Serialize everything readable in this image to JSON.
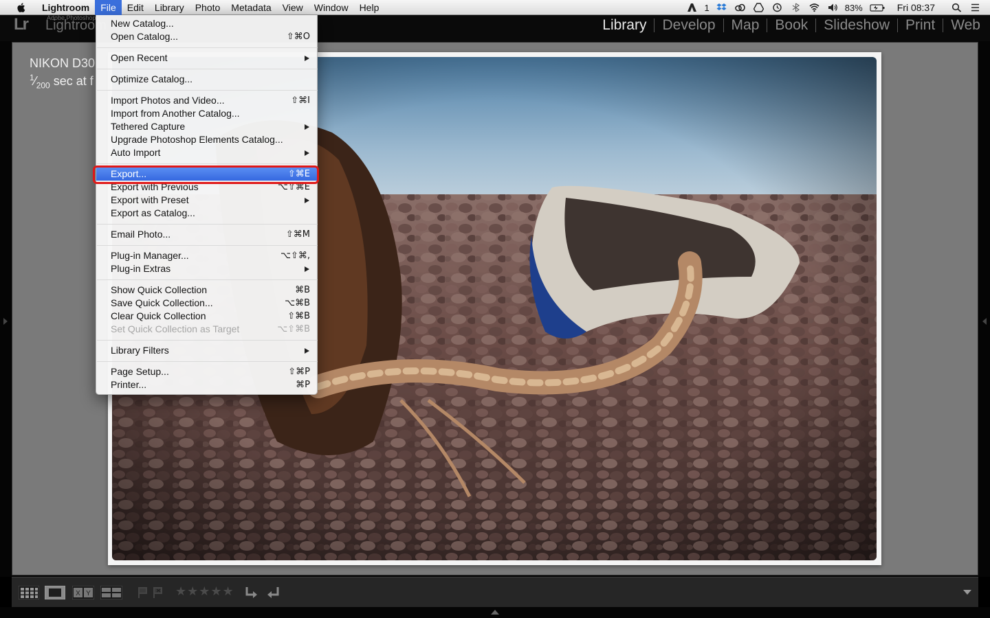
{
  "menubar": {
    "app": "Lightroom",
    "items": [
      "File",
      "Edit",
      "Library",
      "Photo",
      "Metadata",
      "View",
      "Window",
      "Help"
    ],
    "status": {
      "adobe_count": "1",
      "battery": "83%",
      "clock": "Fri 08:37"
    }
  },
  "lr": {
    "adobe_label": "Adobe Photoshop",
    "app_name": "Lightroom",
    "modules": [
      "Library",
      "Develop",
      "Map",
      "Book",
      "Slideshow",
      "Print",
      "Web"
    ],
    "active_module": "Library"
  },
  "photo_info": {
    "camera": "NIKON D30",
    "exposure_sup": "1",
    "exposure_sub": "200",
    "exposure_rest": " sec at f"
  },
  "toolbar": {
    "compare_label": "X|Y",
    "stars": "★★★★★"
  },
  "file_menu": {
    "items": [
      {
        "label": "New Catalog...",
        "shortcut": ""
      },
      {
        "label": "Open Catalog...",
        "shortcut": "⇧⌘O"
      },
      {
        "label": "Open Recent",
        "shortcut": "",
        "submenu": true
      },
      {
        "label": "Optimize Catalog...",
        "shortcut": ""
      },
      {
        "label": "Import Photos and Video...",
        "shortcut": "⇧⌘I"
      },
      {
        "label": "Import from Another Catalog...",
        "shortcut": ""
      },
      {
        "label": "Tethered Capture",
        "shortcut": "",
        "submenu": true
      },
      {
        "label": "Upgrade Photoshop Elements Catalog...",
        "shortcut": ""
      },
      {
        "label": "Auto Import",
        "shortcut": "",
        "submenu": true
      },
      {
        "label": "Export...",
        "shortcut": "⇧⌘E",
        "highlighted": true
      },
      {
        "label": "Export with Previous",
        "shortcut": "⌥⇧⌘E"
      },
      {
        "label": "Export with Preset",
        "shortcut": "",
        "submenu": true
      },
      {
        "label": "Export as Catalog...",
        "shortcut": ""
      },
      {
        "label": "Email Photo...",
        "shortcut": "⇧⌘M"
      },
      {
        "label": "Plug-in Manager...",
        "shortcut": "⌥⇧⌘,"
      },
      {
        "label": "Plug-in Extras",
        "shortcut": "",
        "submenu": true
      },
      {
        "label": "Show Quick Collection",
        "shortcut": "⌘B"
      },
      {
        "label": "Save Quick Collection...",
        "shortcut": "⌥⌘B"
      },
      {
        "label": "Clear Quick Collection",
        "shortcut": "⇧⌘B"
      },
      {
        "label": "Set Quick Collection as Target",
        "shortcut": "⌥⇧⌘B",
        "disabled": true
      },
      {
        "label": "Library Filters",
        "shortcut": "",
        "submenu": true
      },
      {
        "label": "Page Setup...",
        "shortcut": "⇧⌘P"
      },
      {
        "label": "Printer...",
        "shortcut": "⌘P"
      }
    ]
  },
  "colors": {
    "highlight_blue": "#3568e0",
    "callout_red": "#e01818",
    "panel_gray": "#7a7a7a"
  }
}
